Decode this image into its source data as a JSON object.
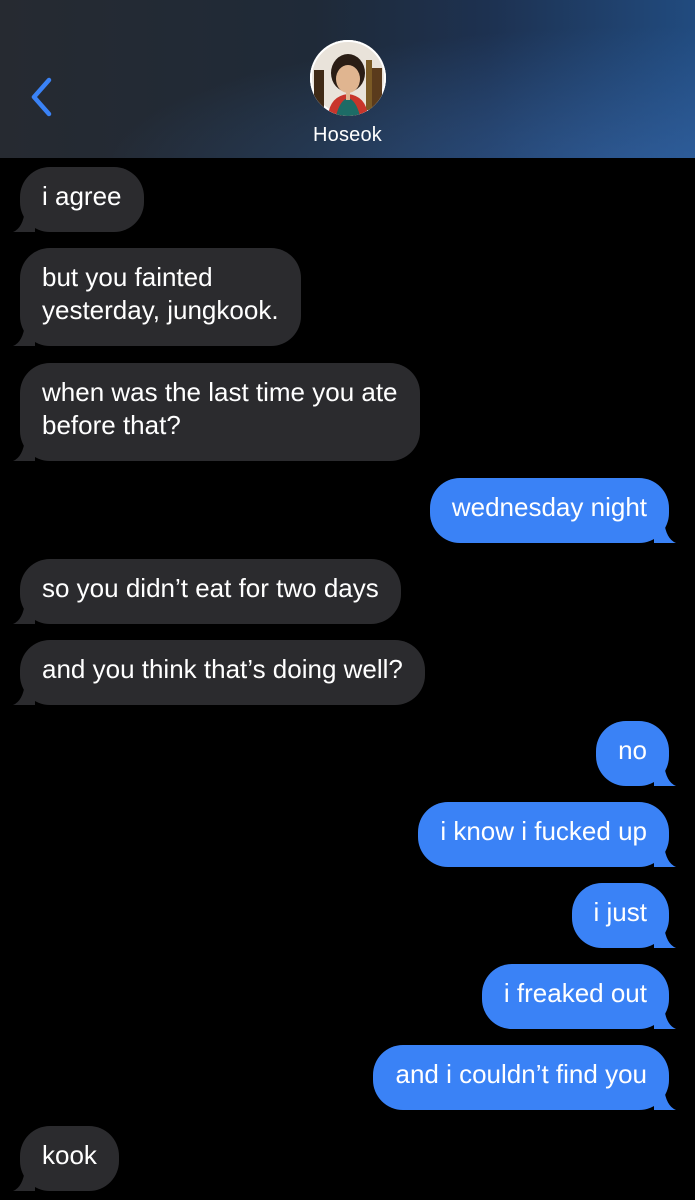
{
  "header": {
    "contact_name": "Hoseok",
    "back_icon": "chevron-left-icon",
    "avatar": "contact-avatar-photo",
    "accent_color": "#3a82f6"
  },
  "messages": [
    {
      "direction": "incoming",
      "text": "i agree"
    },
    {
      "direction": "incoming",
      "text": "but you fainted\nyesterday, jungkook."
    },
    {
      "direction": "incoming",
      "text": "when was the last time you ate\nbefore that?"
    },
    {
      "direction": "outgoing",
      "text": "wednesday night"
    },
    {
      "direction": "incoming",
      "text": "so you didn’t eat for two days"
    },
    {
      "direction": "incoming",
      "text": "and you think that’s doing well?"
    },
    {
      "direction": "outgoing",
      "text": "no"
    },
    {
      "direction": "outgoing",
      "text": "i know i fucked up"
    },
    {
      "direction": "outgoing",
      "text": "i just"
    },
    {
      "direction": "outgoing",
      "text": "i freaked out"
    },
    {
      "direction": "outgoing",
      "text": "and i couldn’t find you"
    },
    {
      "direction": "incoming",
      "text": "kook"
    }
  ],
  "colors": {
    "incoming_bubble": "#2b2b2e",
    "outgoing_bubble": "#3a82f6",
    "background": "#000000"
  }
}
